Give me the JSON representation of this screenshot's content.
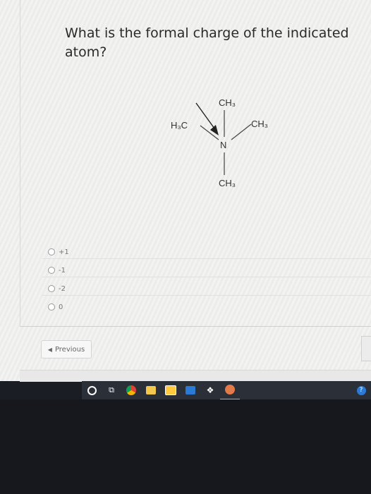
{
  "question": {
    "line1": "What is the formal charge of the indicated",
    "line2": "atom?"
  },
  "molecule": {
    "ch3_top": "CH₃",
    "h3c_left": "H₃C",
    "ch3_right": "CH₃",
    "nitrogen": "N",
    "ch3_bottom": "CH₃"
  },
  "options": [
    {
      "label": "+1"
    },
    {
      "label": "-1"
    },
    {
      "label": "-2"
    },
    {
      "label": "0"
    }
  ],
  "navigation": {
    "previous_label": "Previous"
  },
  "taskbar": {
    "icons": [
      "cortana-circle-icon",
      "task-view-icon",
      "chrome-icon",
      "file-explorer-icon",
      "store-icon",
      "mail-icon",
      "dropbox-icon",
      "photos-icon",
      "help-icon"
    ],
    "colors": {
      "accent_blue": "#2b7bd6",
      "dropbox": "#2b7bd6",
      "store": "#ffc83d"
    }
  }
}
